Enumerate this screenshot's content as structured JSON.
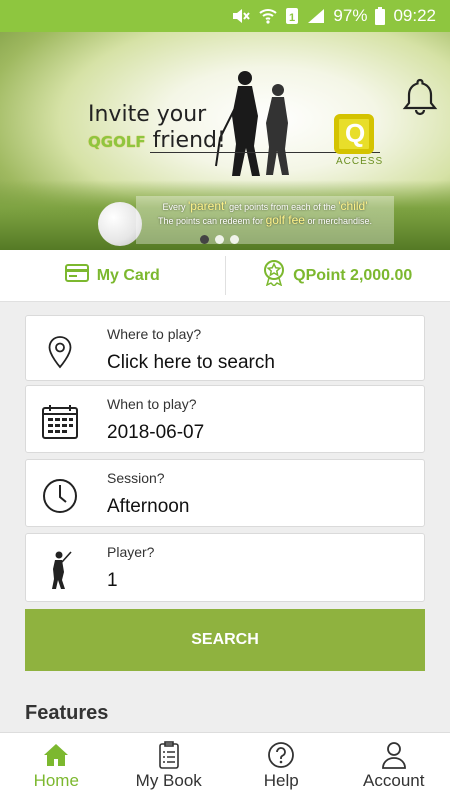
{
  "status_bar": {
    "battery": "97%",
    "time": "09:22"
  },
  "banner": {
    "headline_1": "Invite your",
    "brand": "QGOLF",
    "headline_2": "friend!",
    "logo_letter": "Q",
    "logo_text": "ACCESS",
    "caption_line1_a": "Every",
    "caption_line1_b": "'parent'",
    "caption_line1_c": "get points from each of the",
    "caption_line1_d": "'child'",
    "caption_line2_a": "The points can redeem for",
    "caption_line2_b": "golf fee",
    "caption_line2_c": "or merchandise."
  },
  "card_bar": {
    "my_card": "My Card",
    "qpoint": "QPoint 2,000.00"
  },
  "fields": {
    "where": {
      "label": "Where to play?",
      "value": "Click here to search"
    },
    "when": {
      "label": "When to play?",
      "value": "2018-06-07"
    },
    "session": {
      "label": "Session?",
      "value": "Afternoon"
    },
    "player": {
      "label": "Player?",
      "value": "1"
    }
  },
  "search_button": "SEARCH",
  "features_title": "Features",
  "nav": {
    "home": "Home",
    "my_book": "My Book",
    "help": "Help",
    "account": "Account"
  },
  "colors": {
    "accent": "#8ec63f",
    "button": "#8fb23f",
    "active_nav": "#7cb82f"
  }
}
